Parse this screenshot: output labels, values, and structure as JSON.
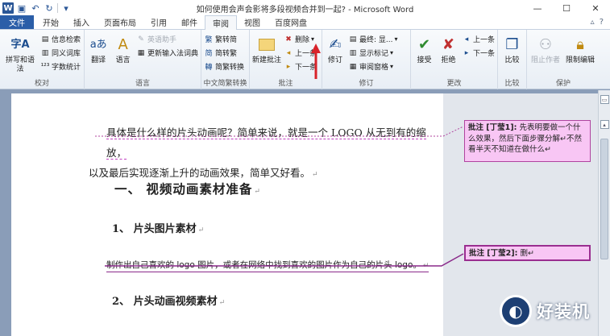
{
  "window": {
    "title": "如何使用会声会影将多段视频合并到一起? - Microsoft Word",
    "minimize": "—",
    "maximize": "☐",
    "close": "✕"
  },
  "tabs": [
    "文件",
    "开始",
    "插入",
    "页面布局",
    "引用",
    "邮件",
    "审阅",
    "视图",
    "百度网盘"
  ],
  "ribbon": {
    "groups": {
      "proofing": {
        "label": "校对",
        "spell": "拼写和语法",
        "research": "信息检索",
        "thesaurus": "同义词库",
        "wordcount": "字数统计"
      },
      "language": {
        "label": "语言",
        "translate": "翻译",
        "language": "语言",
        "english_assistant": "英语助手",
        "update_ime": "更新输入法词典"
      },
      "chinese": {
        "label": "中文简繁转换",
        "to_simp": "繁转简",
        "to_trad": "简转繁",
        "convert": "简繁转换"
      },
      "comments": {
        "label": "批注",
        "new": "新建批注",
        "delete": "删除",
        "prev": "上一条",
        "next": "下一条"
      },
      "tracking": {
        "label": "修订",
        "track": "修订",
        "final": "最终: 显...",
        "show_markup": "显示标记",
        "review_pane": "审阅窗格"
      },
      "changes": {
        "label": "更改",
        "accept": "接受",
        "reject": "拒绝",
        "prev": "上一条",
        "next": "下一条"
      },
      "compare": {
        "label": "比较",
        "compare": "比较"
      },
      "protect": {
        "label": "保护",
        "block_authors": "阻止作者",
        "restrict": "限制编辑"
      }
    }
  },
  "document": {
    "p1_line1": "具体是什么样的片头动画呢？简单来说，就是一个 LOGO 从无到有的缩放，",
    "p1_line2": "以及最后实现逐渐上升的动画效果，简单又好看。",
    "heading1": "一、    视频动画素材准备",
    "heading2": "1、    片头图片素材",
    "p2": "制作出自己喜欢的 logo 图片，或者在网络中找到喜欢的图片作为自己的片头 logo。",
    "heading3": "2、    片头动画视频素材",
    "para_mark": "↵"
  },
  "comments": [
    {
      "label": "批注 [丁莹1]:",
      "text": "先表明要做一个什么效果，然后下面步骤分解↵不然看半天不知道在做什么↵"
    },
    {
      "label": "批注 [丁莹2]:",
      "text": "删↵"
    }
  ],
  "watermark": {
    "text": "好装机"
  }
}
